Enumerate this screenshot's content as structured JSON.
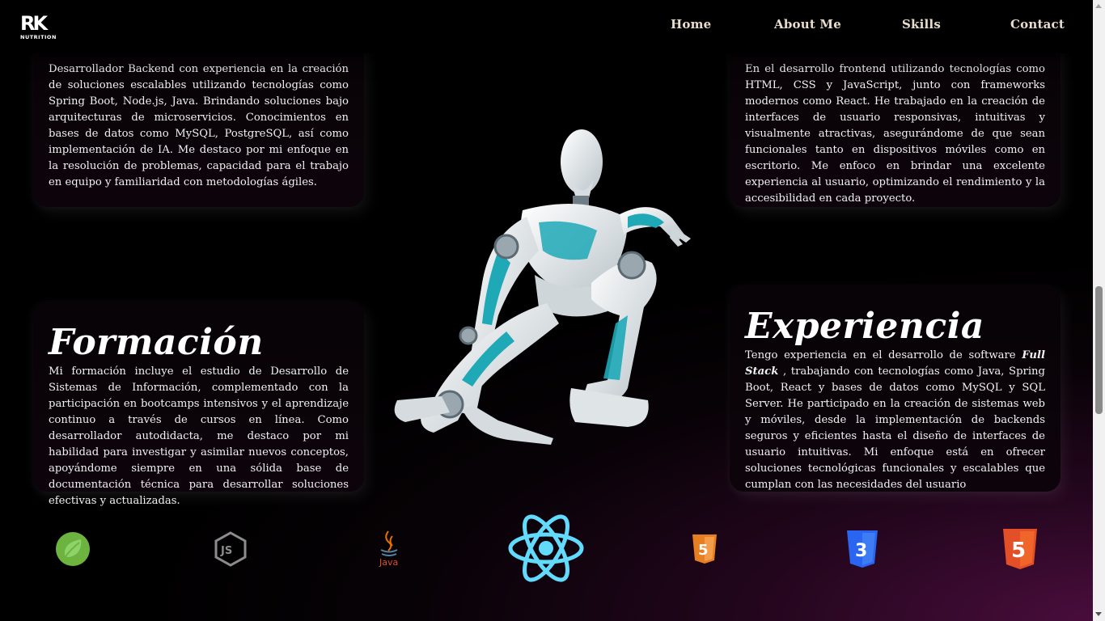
{
  "nav": {
    "logo_text": "RK",
    "logo_sub": "NUTRITION",
    "links": [
      "Home",
      "About Me",
      "Skills",
      "Contact"
    ]
  },
  "cards": {
    "backend": {
      "text": "Desarrollador Backend con experiencia en la creación de soluciones escalables utilizando tecnologías como Spring Boot, Node.js, Java. Brindando soluciones bajo arquitecturas de microservicios. Conocimientos en bases de datos como MySQL, PostgreSQL, así como implementación de IA. Me destaco por mi enfoque en la resolución de problemas, capacidad para el trabajo en equipo y familiaridad con metodologías ágiles."
    },
    "frontend": {
      "text": "En el desarrollo frontend utilizando tecnologías como HTML, CSS y JavaScript, junto con frameworks modernos como React. He trabajado en la creación de interfaces de usuario responsivas, intuitivas y visualmente atractivas, asegurándome de que sean funcionales tanto en dispositivos móviles como en escritorio. Me enfoco en brindar una excelente experiencia al usuario, optimizando el rendimiento y la accesibilidad en cada proyecto."
    },
    "formacion": {
      "title": "Formación",
      "text": "Mi formación incluye el estudio de Desarrollo de Sistemas de Información, complementado con la participación en bootcamps intensivos y el aprendizaje continuo a través de cursos en línea. Como desarrollador autodidacta, me destaco por mi habilidad para investigar y asimilar nuevos conceptos, apoyándome siempre en una sólida base de documentación técnica para desarrollar soluciones efectivas y actualizadas."
    },
    "experiencia": {
      "title": "Experiencia",
      "text_before": "Tengo experiencia en el desarrollo de software",
      "text_bold": "Full Stack",
      "text_after": ", trabajando con tecnologías como Java, Spring Boot, React y bases de datos como MySQL y SQL Server. He participado en la creación de sistemas web y móviles, desde la implementación de backends seguros y eficientes hasta el diseño de interfaces de usuario intuitivas. Mi enfoque está en ofrecer soluciones tecnológicas funcionales y escalables que cumplan con las necesidades del usuario"
    }
  },
  "tech_icons": [
    {
      "name": "spring-icon",
      "color": "#6db33f"
    },
    {
      "name": "nodejs-icon",
      "color": "#8c8c8c"
    },
    {
      "name": "java-icon",
      "color": "#e76f00",
      "label": "Java"
    },
    {
      "name": "react-icon",
      "color": "#61dafb"
    },
    {
      "name": "html5-orange-icon",
      "color": "#e67e22",
      "label": "5"
    },
    {
      "name": "css3-icon",
      "color": "#2965f1",
      "label": "3"
    },
    {
      "name": "html5-red-icon",
      "color": "#e34f26",
      "label": "5"
    }
  ]
}
